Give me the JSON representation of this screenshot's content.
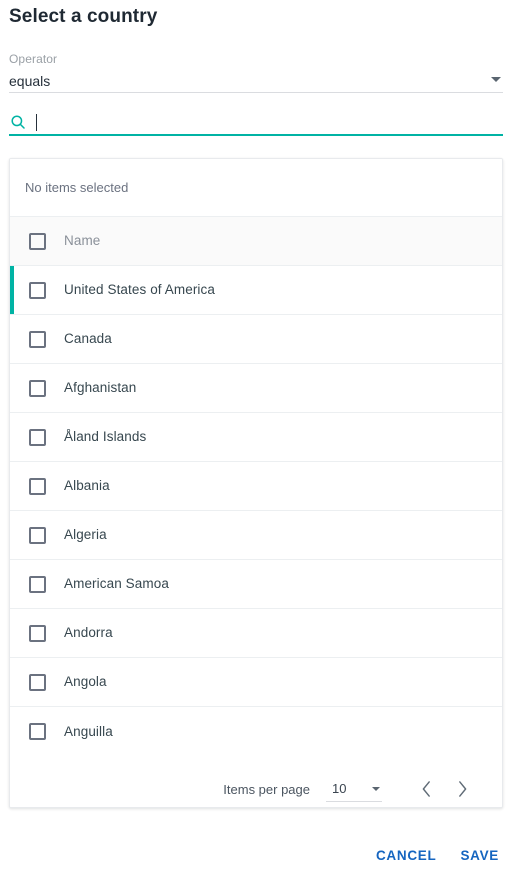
{
  "dialog": {
    "title": "Select a country"
  },
  "operator": {
    "label": "Operator",
    "value": "equals",
    "arrow_icon": "chevron-down-icon"
  },
  "search": {
    "icon": "search-icon",
    "value": "",
    "placeholder": ""
  },
  "list": {
    "selection_summary": "No items selected",
    "header": {
      "name_column": "Name"
    },
    "rows": [
      {
        "name": "United States of America",
        "marked": true
      },
      {
        "name": "Canada",
        "marked": false
      },
      {
        "name": "Afghanistan",
        "marked": false
      },
      {
        "name": "Åland Islands",
        "marked": false
      },
      {
        "name": "Albania",
        "marked": false
      },
      {
        "name": "Algeria",
        "marked": false
      },
      {
        "name": "American Samoa",
        "marked": false
      },
      {
        "name": "Andorra",
        "marked": false
      },
      {
        "name": "Angola",
        "marked": false
      },
      {
        "name": "Anguilla",
        "marked": false
      }
    ]
  },
  "paginator": {
    "items_per_page_label": "Items per page",
    "items_per_page_value": "10",
    "prev_icon": "chevron-left-icon",
    "next_icon": "chevron-right-icon"
  },
  "actions": {
    "cancel_label": "CANCEL",
    "save_label": "SAVE"
  },
  "colors": {
    "accent_teal": "#00b3a4",
    "action_blue": "#1565c0",
    "header_row_bg": "#fafafa",
    "border": "#eceff1"
  }
}
